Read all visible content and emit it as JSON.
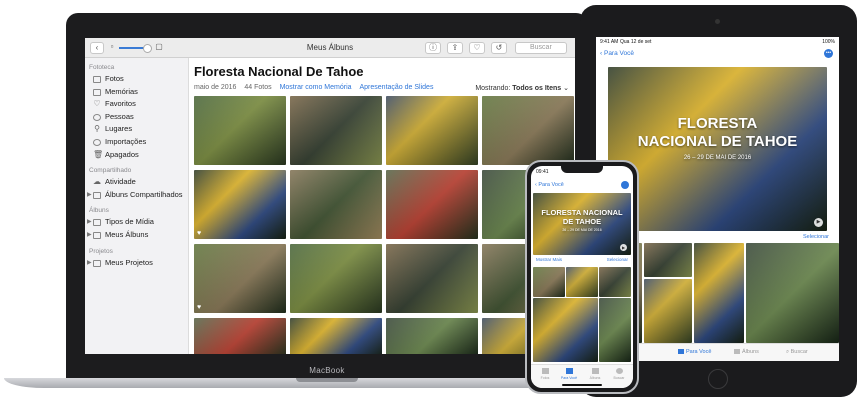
{
  "mac": {
    "brand": "MacBook",
    "toolbar": {
      "title": "Meus Álbuns",
      "search_placeholder": "Buscar",
      "back_icon": "chevron-left-icon",
      "icons": [
        "info-icon",
        "share-icon",
        "heart-icon",
        "rotate-icon"
      ]
    },
    "sidebar": {
      "sections": [
        {
          "title": "Fototeca",
          "items": [
            {
              "label": "Fotos",
              "icon": "photos-icon"
            },
            {
              "label": "Memórias",
              "icon": "memories-icon"
            },
            {
              "label": "Favoritos",
              "icon": "heart-icon"
            },
            {
              "label": "Pessoas",
              "icon": "people-icon"
            },
            {
              "label": "Lugares",
              "icon": "pin-icon"
            },
            {
              "label": "Importações",
              "icon": "clock-icon"
            },
            {
              "label": "Apagados",
              "icon": "trash-icon"
            }
          ]
        },
        {
          "title": "Compartilhado",
          "items": [
            {
              "label": "Atividade",
              "icon": "cloud-icon"
            },
            {
              "label": "Álbuns Compartilhados",
              "icon": "folder-icon"
            }
          ]
        },
        {
          "title": "Álbuns",
          "items": [
            {
              "label": "Tipos de Mídia",
              "icon": "folder-icon"
            },
            {
              "label": "Meus Álbuns",
              "icon": "folder-icon"
            }
          ]
        },
        {
          "title": "Projetos",
          "items": [
            {
              "label": "Meus Projetos",
              "icon": "folder-icon"
            }
          ]
        }
      ]
    },
    "main": {
      "title": "Floresta Nacional De Tahoe",
      "date": "maio de 2016",
      "count": "44 Fotos",
      "link_memory": "Mostrar como Memória",
      "link_slides": "Apresentação de Slides",
      "showing_label": "Mostrando:",
      "showing_value": "Todos os Itens"
    }
  },
  "ipad": {
    "status_time": "9:41 AM",
    "status_date": "Qua 12 de set",
    "status_battery": "100%",
    "back_label": "Para Você",
    "hero_title_line1": "FLORESTA",
    "hero_title_line2": "NACIONAL DE TAHOE",
    "hero_dates": "26 – 29 DE MAI DE 2016",
    "select_label": "Selecionar",
    "tabs": [
      {
        "label": "Para Você",
        "active": true
      },
      {
        "label": "Álbuns",
        "active": false
      },
      {
        "label": "Buscar",
        "active": false
      }
    ]
  },
  "iphone": {
    "status_time": "09:41",
    "back_label": "Para Você",
    "hero_title_line1": "FLORESTA NACIONAL",
    "hero_title_line2": "DE TAHOE",
    "hero_dates": "26 – 29 DE MAI DE 2016",
    "show_more": "Mostrar Mais",
    "select_label": "Selecionar",
    "tabs": [
      {
        "label": "Fotos",
        "active": false
      },
      {
        "label": "Para Você",
        "active": true
      },
      {
        "label": "Álbuns",
        "active": false
      },
      {
        "label": "Buscar",
        "active": false
      }
    ]
  },
  "colors": {
    "accent": "#2f76d8",
    "device_black": "#1c1c1e",
    "mac_silver": "#c9cacf"
  }
}
